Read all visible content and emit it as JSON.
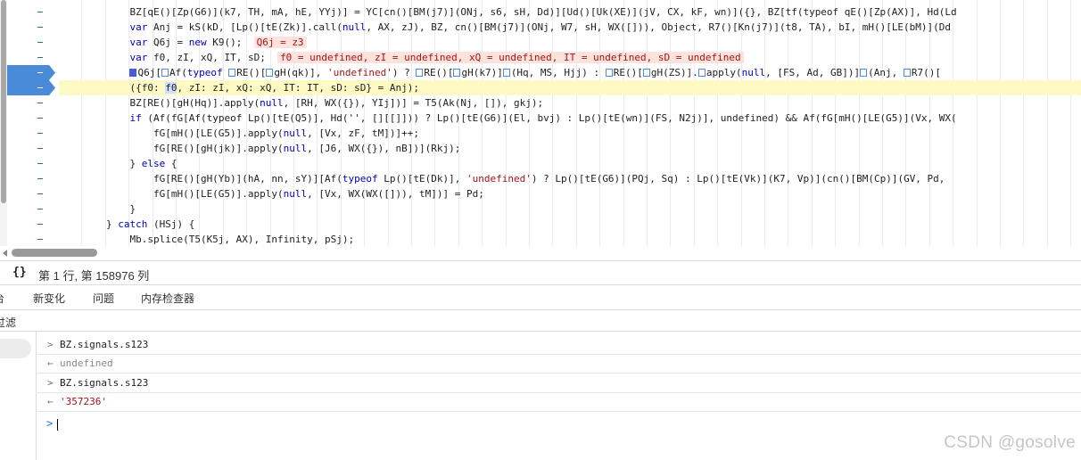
{
  "editor": {
    "breakpoint_rows": [
      4,
      5
    ],
    "lines": [
      [
        {
          "t": "            BZ[qE()[Zp(G6)](k7, TH, mA, hE, YYj)] = YC[cn()[BM(j7)](ONj, s6, sH, Dd)][Ud()[Uk(XE)](jV, CX, kF, wn)]({}, BZ[tf(typeof qE()[Zp(AX)], Hd(Ld"
        }
      ],
      [
        {
          "t": "            "
        },
        {
          "t": "var",
          "c": "kw"
        },
        {
          "t": " Anj = kS(kD, [Lp()[tE(Zk)].call("
        },
        {
          "t": "null",
          "c": "kw"
        },
        {
          "t": ", AX, zJ), BZ, cn()[BM(j7)](ONj, W7, sH, WX([])), Object, R7()[Kn(j7)](t8, TA), bI, mH()[LE(bM)](Dd"
        }
      ],
      [
        {
          "t": "            "
        },
        {
          "t": "var",
          "c": "kw"
        },
        {
          "t": " Q6j = "
        },
        {
          "t": "new",
          "c": "kw"
        },
        {
          "t": " K9();  "
        },
        {
          "t": "Q6j = z3",
          "c": "pink"
        }
      ],
      [
        {
          "t": "            "
        },
        {
          "t": "var",
          "c": "kw"
        },
        {
          "t": " f0, zI, xQ, IT, sD;  "
        },
        {
          "t": "f0 = undefined, zI = undefined, xQ = undefined, IT = undefined, sD = undefined",
          "c": "pink"
        }
      ],
      [
        {
          "t": "            "
        },
        {
          "t": "",
          "c": "arrf"
        },
        {
          "t": "Q6j["
        },
        {
          "t": "",
          "c": "arr"
        },
        {
          "t": "Af("
        },
        {
          "t": "typeof",
          "c": "kw"
        },
        {
          "t": " "
        },
        {
          "t": "",
          "c": "arr"
        },
        {
          "t": "RE()["
        },
        {
          "t": "",
          "c": "arr"
        },
        {
          "t": "gH(qk)], "
        },
        {
          "t": "'undefined'",
          "c": "str"
        },
        {
          "t": ") ? "
        },
        {
          "t": "",
          "c": "arr"
        },
        {
          "t": "RE()["
        },
        {
          "t": "",
          "c": "arr"
        },
        {
          "t": "gH(k7)]"
        },
        {
          "t": "",
          "c": "arr"
        },
        {
          "t": "(Hq, MS, Hjj) : "
        },
        {
          "t": "",
          "c": "arr"
        },
        {
          "t": "RE()["
        },
        {
          "t": "",
          "c": "arr"
        },
        {
          "t": "gH(ZS)]."
        },
        {
          "t": "",
          "c": "arr"
        },
        {
          "t": "apply("
        },
        {
          "t": "null",
          "c": "kw"
        },
        {
          "t": ", [FS, Ad, GB])]"
        },
        {
          "t": "",
          "c": "arr"
        },
        {
          "t": "(Anj, "
        },
        {
          "t": "",
          "c": "arr"
        },
        {
          "t": "R7()["
        }
      ],
      [
        {
          "t": "            ({f0: "
        },
        {
          "t": "f0",
          "c": "selw"
        },
        {
          "t": ", zI: zI, xQ: xQ, IT: IT, sD: sD} = Anj);"
        }
      ],
      [
        {
          "t": "            BZ[RE()[gH(Hq)].apply("
        },
        {
          "t": "null",
          "c": "kw"
        },
        {
          "t": ", [RH, WX({}), YIj])] = T5(Ak(Nj, []), gkj);"
        }
      ],
      [
        {
          "t": "            "
        },
        {
          "t": "if",
          "c": "kw"
        },
        {
          "t": " (Af(fG[Af(typeof Lp()[tE(Q5)], Hd('', [][[]])) ? Lp()[tE(G6)](El, bvj) : Lp()[tE(wn)](FS, N2j)], undefined) && Af(fG[mH()[LE(G5)](Vx, WX("
        }
      ],
      [
        {
          "t": "                fG[mH()[LE(G5)].apply("
        },
        {
          "t": "null",
          "c": "kw"
        },
        {
          "t": ", [Vx, zF, tM])]++;"
        }
      ],
      [
        {
          "t": "                fG[RE()[gH(jk)].apply("
        },
        {
          "t": "null",
          "c": "kw"
        },
        {
          "t": ", [J6, WX({}), nB])](Rkj);"
        }
      ],
      [
        {
          "t": "            } "
        },
        {
          "t": "else",
          "c": "kw"
        },
        {
          "t": " {"
        }
      ],
      [
        {
          "t": "                fG[RE()[gH(Yb)](hA, nn, sY)][Af("
        },
        {
          "t": "typeof",
          "c": "kw"
        },
        {
          "t": " Lp()[tE(Dk)], "
        },
        {
          "t": "'undefined'",
          "c": "str"
        },
        {
          "t": ") ? Lp()[tE(G6)](PQj, Sq) : Lp()[tE(Vk)](K7, Vp)](cn()[BM(Cp)](GV, Pd, "
        }
      ],
      [
        {
          "t": "                fG[mH()[LE(G5)].apply("
        },
        {
          "t": "null",
          "c": "kw"
        },
        {
          "t": ", [Vx, WX(WX([])), tM])] = Pd;"
        }
      ],
      [
        {
          "t": "            }"
        }
      ],
      [
        {
          "t": "        } "
        },
        {
          "t": "catch",
          "c": "kw"
        },
        {
          "t": " (HSj) {"
        }
      ],
      [
        {
          "t": "            Mb.splice(T5(K5j, AX), Infinity, pSj);"
        }
      ]
    ]
  },
  "status": {
    "braces_icon": "{}",
    "position_text": "第 1 行, 第 158976 列"
  },
  "drawer_tabs": [
    "台",
    "新变化",
    "问题",
    "内存检查器"
  ],
  "filter_label": "过滤",
  "console": {
    "entries": [
      {
        "icon": "expand-arrow-icon",
        "glyph": ">",
        "text": "BZ.signals.s123",
        "kind": "input"
      },
      {
        "icon": "return-arrow-icon",
        "glyph": "←",
        "text": "undefined",
        "kind": "undefined"
      },
      {
        "icon": "expand-arrow-icon",
        "glyph": ">",
        "text": "BZ.signals.s123",
        "kind": "input"
      },
      {
        "icon": "return-arrow-icon",
        "glyph": "←",
        "text": "'357236'",
        "kind": "string"
      }
    ],
    "prompt_glyph": ">"
  },
  "watermark": "CSDN @gosolve"
}
